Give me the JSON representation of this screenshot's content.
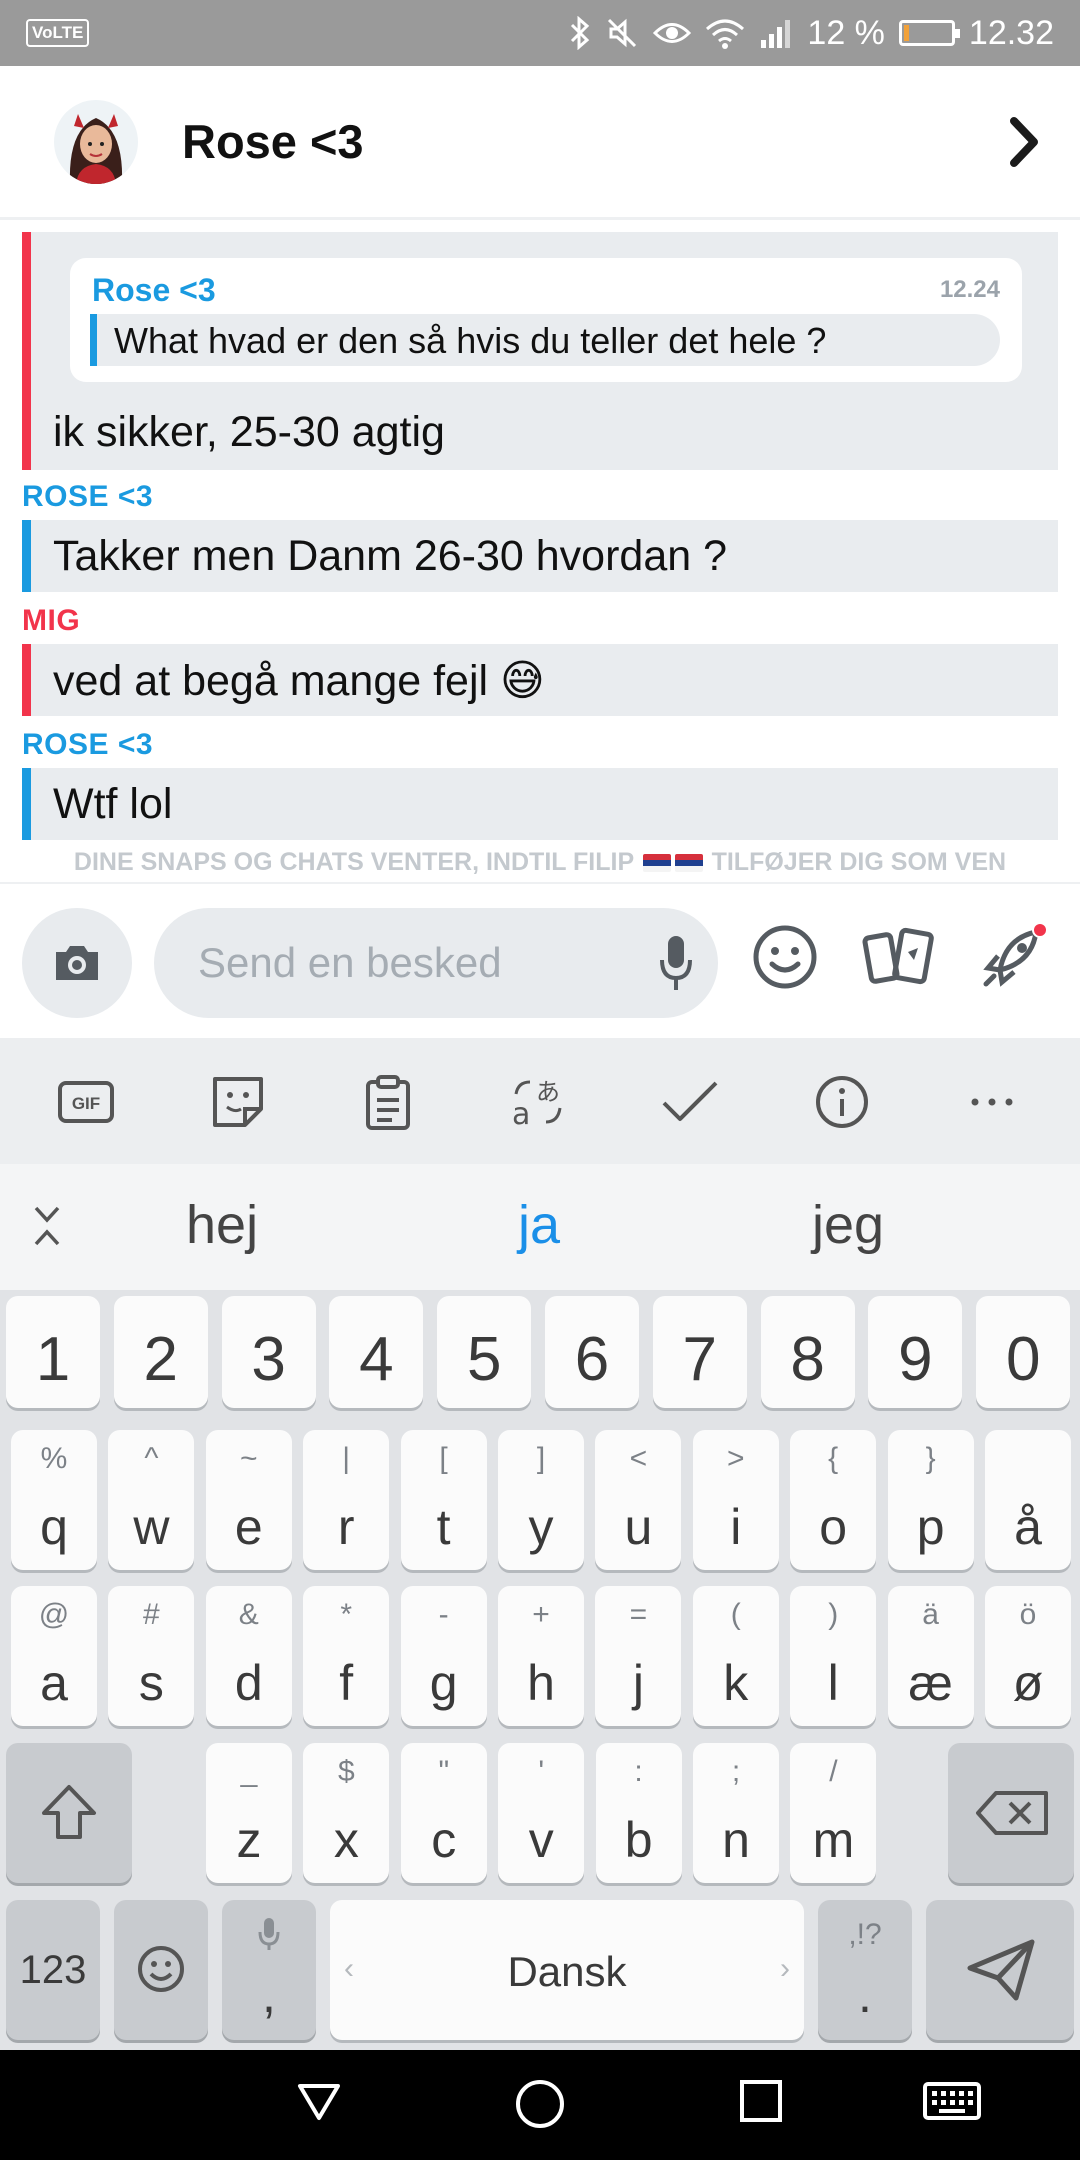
{
  "status_bar": {
    "network_badge": "VoLTE",
    "battery_percent": "12 %",
    "battery_level": 0.12,
    "time": "12.32",
    "icons": [
      "bluetooth-icon",
      "mute-icon",
      "eye-icon",
      "wifi-icon",
      "signal-icon",
      "battery-icon"
    ]
  },
  "header": {
    "title": "Rose <3",
    "avatar_icon": "bitmoji-avatar",
    "next_icon": "chevron-right-icon"
  },
  "chat": {
    "messages": [
      {
        "sender": "",
        "bar_color": "#f2344b",
        "quote": {
          "name": "Rose <3",
          "time": "12.24",
          "text": "What hvad er den så hvis du teller det hele ?"
        },
        "text": "ik sikker, 25-30 agtig"
      },
      {
        "sender": "ROSE <3",
        "sender_color": "#1a9ae0",
        "bar_color": "#1a9ae0",
        "text": "Takker men Danm 26-30 hvordan ?"
      },
      {
        "sender": "MIG",
        "sender_color": "#f2344b",
        "bar_color": "#f2344b",
        "text": "ved at begå mange fejl 😅"
      },
      {
        "sender": "ROSE <3",
        "sender_color": "#1a9ae0",
        "bar_color": "#1a9ae0",
        "text": "Wtf lol"
      }
    ],
    "notice_left": "DINE SNAPS OG CHATS VENTER, INDTIL FILIP",
    "notice_right": "TILFØJER DIG SOM VEN"
  },
  "input_row": {
    "placeholder": "Send en besked",
    "icons": [
      "camera-icon",
      "microphone-icon",
      "smiley-icon",
      "cards-icon",
      "rocket-icon"
    ]
  },
  "keyboard": {
    "toolbar": [
      "gif-icon",
      "sticker-icon",
      "clipboard-icon",
      "translate-icon",
      "handwriting-icon",
      "info-icon",
      "more-icon"
    ],
    "toolbar_gif": "GIF",
    "suggestions": [
      "hej",
      "ja",
      "jeg"
    ],
    "number_row": [
      "1",
      "2",
      "3",
      "4",
      "5",
      "6",
      "7",
      "8",
      "9",
      "0"
    ],
    "row1": [
      [
        "q",
        "%"
      ],
      [
        "w",
        "^"
      ],
      [
        "e",
        "~"
      ],
      [
        "r",
        "|"
      ],
      [
        "t",
        "["
      ],
      [
        "y",
        "]"
      ],
      [
        "u",
        "<"
      ],
      [
        "i",
        ">"
      ],
      [
        "o",
        "{"
      ],
      [
        "p",
        "}"
      ],
      [
        "å",
        ""
      ]
    ],
    "row2": [
      [
        "a",
        "@"
      ],
      [
        "s",
        "#"
      ],
      [
        "d",
        "&"
      ],
      [
        "f",
        "*"
      ],
      [
        "g",
        "-"
      ],
      [
        "h",
        "+"
      ],
      [
        "j",
        "="
      ],
      [
        "k",
        "("
      ],
      [
        "l",
        ")"
      ],
      [
        "æ",
        "ä"
      ],
      [
        "ø",
        "ö"
      ]
    ],
    "row3": [
      [
        "z",
        "_"
      ],
      [
        "x",
        "$"
      ],
      [
        "c",
        "\""
      ],
      [
        "v",
        "'"
      ],
      [
        "b",
        ":"
      ],
      [
        "n",
        ";"
      ],
      [
        "m",
        "/"
      ]
    ],
    "mode_key": "123",
    "comma_key": ",",
    "space_label": "Dansk",
    "period_key": ".",
    "period_sub": ",!?",
    "accent_color": "#1a8fe8"
  },
  "nav_bar": {
    "icons": [
      "back-icon",
      "home-icon",
      "recents-icon",
      "keyboard-icon"
    ]
  }
}
